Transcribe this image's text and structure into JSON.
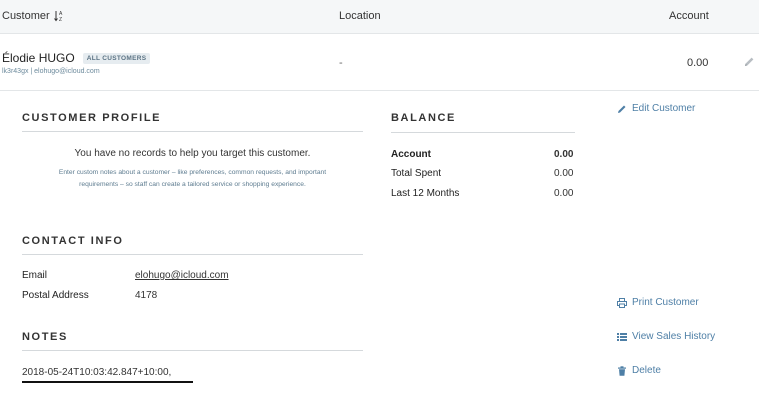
{
  "table": {
    "headers": {
      "customer": "Customer",
      "location": "Location",
      "account": "Account"
    },
    "row": {
      "name": "Élodie HUGO",
      "badge": "ALL CUSTOMERS",
      "sub": "lk3r43gx | elohugo@icloud.com",
      "location": "-",
      "account": "0.00"
    }
  },
  "profile": {
    "title": "CUSTOMER PROFILE",
    "message": "You have no records to help you target this customer.",
    "hint": "Enter custom notes about a customer – like preferences, common requests, and important requirements – so staff can create a tailored service or shopping experience."
  },
  "balance": {
    "title": "BALANCE",
    "rows": [
      {
        "label": "Account",
        "value": "0.00"
      },
      {
        "label": "Total Spent",
        "value": "0.00"
      },
      {
        "label": "Last 12 Months",
        "value": "0.00"
      }
    ]
  },
  "contact": {
    "title": "CONTACT INFO",
    "email_label": "Email",
    "email": "elohugo@icloud.com",
    "postal_label": "Postal Address",
    "postal": "4178"
  },
  "notes": {
    "title": "NOTES",
    "value": "2018-05-24T10:03:42.847+10:00,"
  },
  "actions": {
    "edit": "Edit Customer",
    "print": "Print Customer",
    "history": "View Sales History",
    "delete": "Delete"
  },
  "colors": {
    "accent": "#4e7fa6",
    "header_bg": "#f5f7f8"
  },
  "icons": [
    "sort-alpha-icon",
    "pencil-icon",
    "edit-icon",
    "print-icon",
    "list-icon",
    "trash-icon"
  ]
}
